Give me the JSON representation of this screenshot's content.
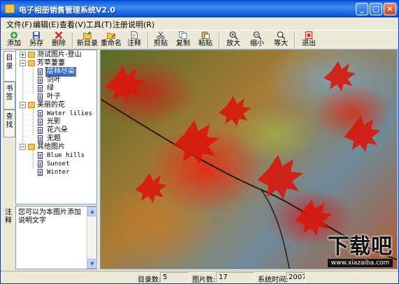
{
  "window": {
    "title": "电子相册销售管理系统V2.0"
  },
  "menu": [
    "文件(F)",
    "编辑(E)",
    "查看(V)",
    "工具(T)",
    "注册说明(R)"
  ],
  "toolbar": [
    {
      "label": "添加",
      "icon": "add-icon",
      "color": "#2e9e3a"
    },
    {
      "label": "另存",
      "icon": "save-icon",
      "color": "#3b5bb5"
    },
    {
      "label": "删除",
      "icon": "delete-icon",
      "color": "#d0261c"
    },
    {
      "label": "新目录",
      "icon": "new-folder-icon",
      "color": "#d8a21c"
    },
    {
      "label": "重命名",
      "icon": "rename-icon",
      "color": "#c28a16"
    },
    {
      "label": "注释",
      "icon": "note-icon",
      "color": "#6a6a6a"
    },
    {
      "label": "剪贴",
      "icon": "cut-icon",
      "color": "#3e5a9a"
    },
    {
      "label": "复制",
      "icon": "copy-icon",
      "color": "#6a7aa0"
    },
    {
      "label": "粘贴",
      "icon": "paste-icon",
      "color": "#b38a3a"
    },
    {
      "label": "放大",
      "icon": "zoom-in-icon",
      "color": "#333333"
    },
    {
      "label": "缩小",
      "icon": "zoom-out-icon",
      "color": "#333333"
    },
    {
      "label": "等大",
      "icon": "actual-size-icon",
      "color": "#333333"
    },
    {
      "label": "退出",
      "icon": "exit-icon",
      "color": "#d0261c"
    }
  ],
  "side_tabs": [
    "目录",
    "书签",
    "查找"
  ],
  "tree": [
    {
      "label": "测试图片-登山",
      "type": "folder",
      "level": 0,
      "expander": "+"
    },
    {
      "label": "芳草萋萋",
      "type": "folder",
      "level": 0,
      "expander": "−"
    },
    {
      "label": "层林尽染",
      "type": "leaf",
      "level": 1,
      "selected": true
    },
    {
      "label": "剑叶",
      "type": "leaf",
      "level": 1
    },
    {
      "label": "绿",
      "type": "leaf",
      "level": 1
    },
    {
      "label": "叶子",
      "type": "leaf",
      "level": 1
    },
    {
      "label": "美丽的花",
      "type": "folder",
      "level": 0,
      "expander": "−"
    },
    {
      "label": "Water lilies",
      "type": "leaf",
      "level": 1
    },
    {
      "label": "光影",
      "type": "leaf",
      "level": 1
    },
    {
      "label": "花六朵",
      "type": "leaf",
      "level": 1
    },
    {
      "label": "无题",
      "type": "leaf",
      "level": 1
    },
    {
      "label": "其他图片",
      "type": "folder",
      "level": 0,
      "expander": "−"
    },
    {
      "label": "Blue hills",
      "type": "leaf",
      "level": 1
    },
    {
      "label": "Sunset",
      "type": "leaf",
      "level": 1
    },
    {
      "label": "Winter",
      "type": "leaf",
      "level": 1
    }
  ],
  "notes": {
    "label": "注释",
    "text": "您可以为本图片添加说明文字"
  },
  "watermark": {
    "main": "下载吧",
    "sub": "www.xiazaiba.com"
  },
  "status": {
    "dir_label": "目录数:",
    "dir_value": "5",
    "pic_label": "图片数:",
    "pic_value": "17",
    "time_label": "系统时间:",
    "time_value": "2007-"
  }
}
